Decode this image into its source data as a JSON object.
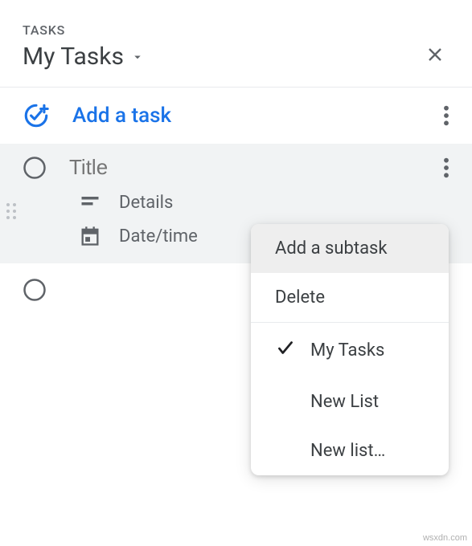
{
  "header": {
    "label": "TASKS",
    "title": "My Tasks"
  },
  "add_task": {
    "label": "Add a task"
  },
  "task": {
    "title_placeholder": "Title",
    "details_label": "Details",
    "datetime_label": "Date/time"
  },
  "menu": {
    "add_subtask": "Add a subtask",
    "delete": "Delete",
    "lists": [
      {
        "label": "My Tasks",
        "checked": true
      },
      {
        "label": "New List",
        "checked": false
      },
      {
        "label": "New list…",
        "checked": false
      }
    ]
  },
  "watermark": "wsxdn.com"
}
